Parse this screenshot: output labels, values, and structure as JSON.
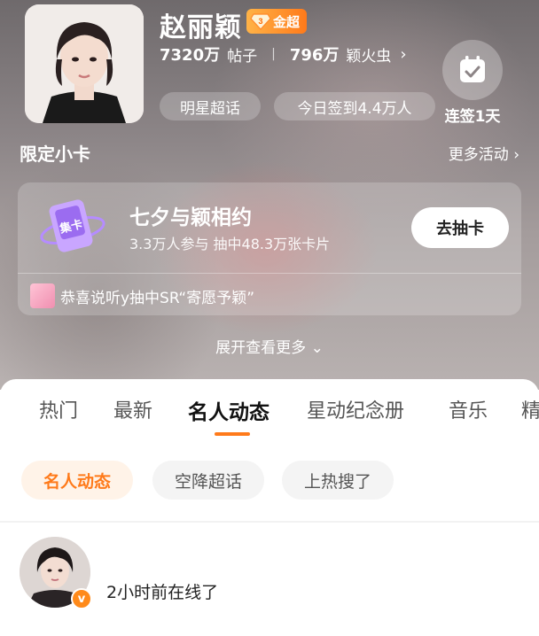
{
  "profile": {
    "name": "赵丽颖",
    "badge_level": "3",
    "badge_label": "金超",
    "posts_count": "7320万",
    "posts_label": "帖子",
    "fans_count": "796万",
    "fans_label": "颖火虫",
    "super_topic_label": "明星超话",
    "today_checkin": "今日签到4.4万人",
    "checkin_streak": "连签1天"
  },
  "section": {
    "title": "限定小卡",
    "more_label": "更多活动"
  },
  "card": {
    "art_text": "集卡",
    "title": "七夕与颖相约",
    "subtitle": "3.3万人参与 抽中48.3万张卡片",
    "button_label": "去抽卡",
    "congrats_text": "恭喜说听y抽中SR“寄愿予颖”"
  },
  "expand_label": "展开查看更多",
  "tabs": [
    "热门",
    "最新",
    "名人动态",
    "星动纪念册",
    "音乐",
    "精"
  ],
  "active_tab": "名人动态",
  "chips": [
    "名人动态",
    "空降超话",
    "上热搜了"
  ],
  "post": {
    "verified_mark": "v",
    "status_text": "2小时前在线了"
  },
  "colors": {
    "accent": "#ff7a1a",
    "badge_gradient_start": "#ffb347",
    "chip_active_bg": "#fff3e8"
  }
}
